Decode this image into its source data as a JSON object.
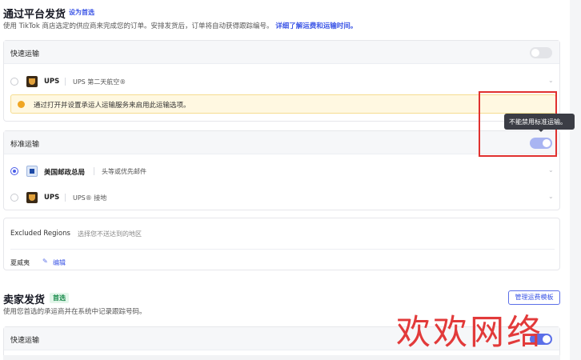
{
  "platform_shipping": {
    "title": "通过平台发货",
    "set_default_link": "设为首选",
    "description": "使用 TikTok 商店选定的供应商来完成您的订单。安排发货后，订单将自动获得跟踪编号。",
    "learn_more_link": "详细了解运费和运输时间。"
  },
  "express": {
    "label": "快速运输",
    "toggle": "off",
    "options": [
      {
        "carrier": "UPS",
        "service": "UPS 第二天航空®",
        "selected": false
      }
    ],
    "warning": "通过打开并设置承运人运输服务来启用此运输选项。"
  },
  "standard": {
    "label": "标准运输",
    "toggle": "on",
    "tooltip": "不能禁用标准运输。",
    "options": [
      {
        "carrier": "美国邮政总局",
        "service": "头等或优先邮件",
        "selected": true
      },
      {
        "carrier": "UPS",
        "service": "UPS® 接地",
        "selected": false
      }
    ]
  },
  "excluded_regions": {
    "title": "Excluded Regions",
    "subtitle": "选择您不送达到的地区",
    "region": "夏威夷",
    "edit": "编辑"
  },
  "seller_shipping": {
    "title": "卖家发货",
    "badge": "首选",
    "description": "使用您首选的承运商并在系统中记录跟踪号码。",
    "manage_button": "管理运费模板",
    "express_label": "快速运输",
    "express_toggle": "on"
  },
  "watermark": "欢欢网络",
  "colors": {
    "accent": "#3b55e6",
    "toggle_on": "#5b6fe8",
    "warning_bg": "#fff8e1",
    "highlight": "#e0312f"
  }
}
